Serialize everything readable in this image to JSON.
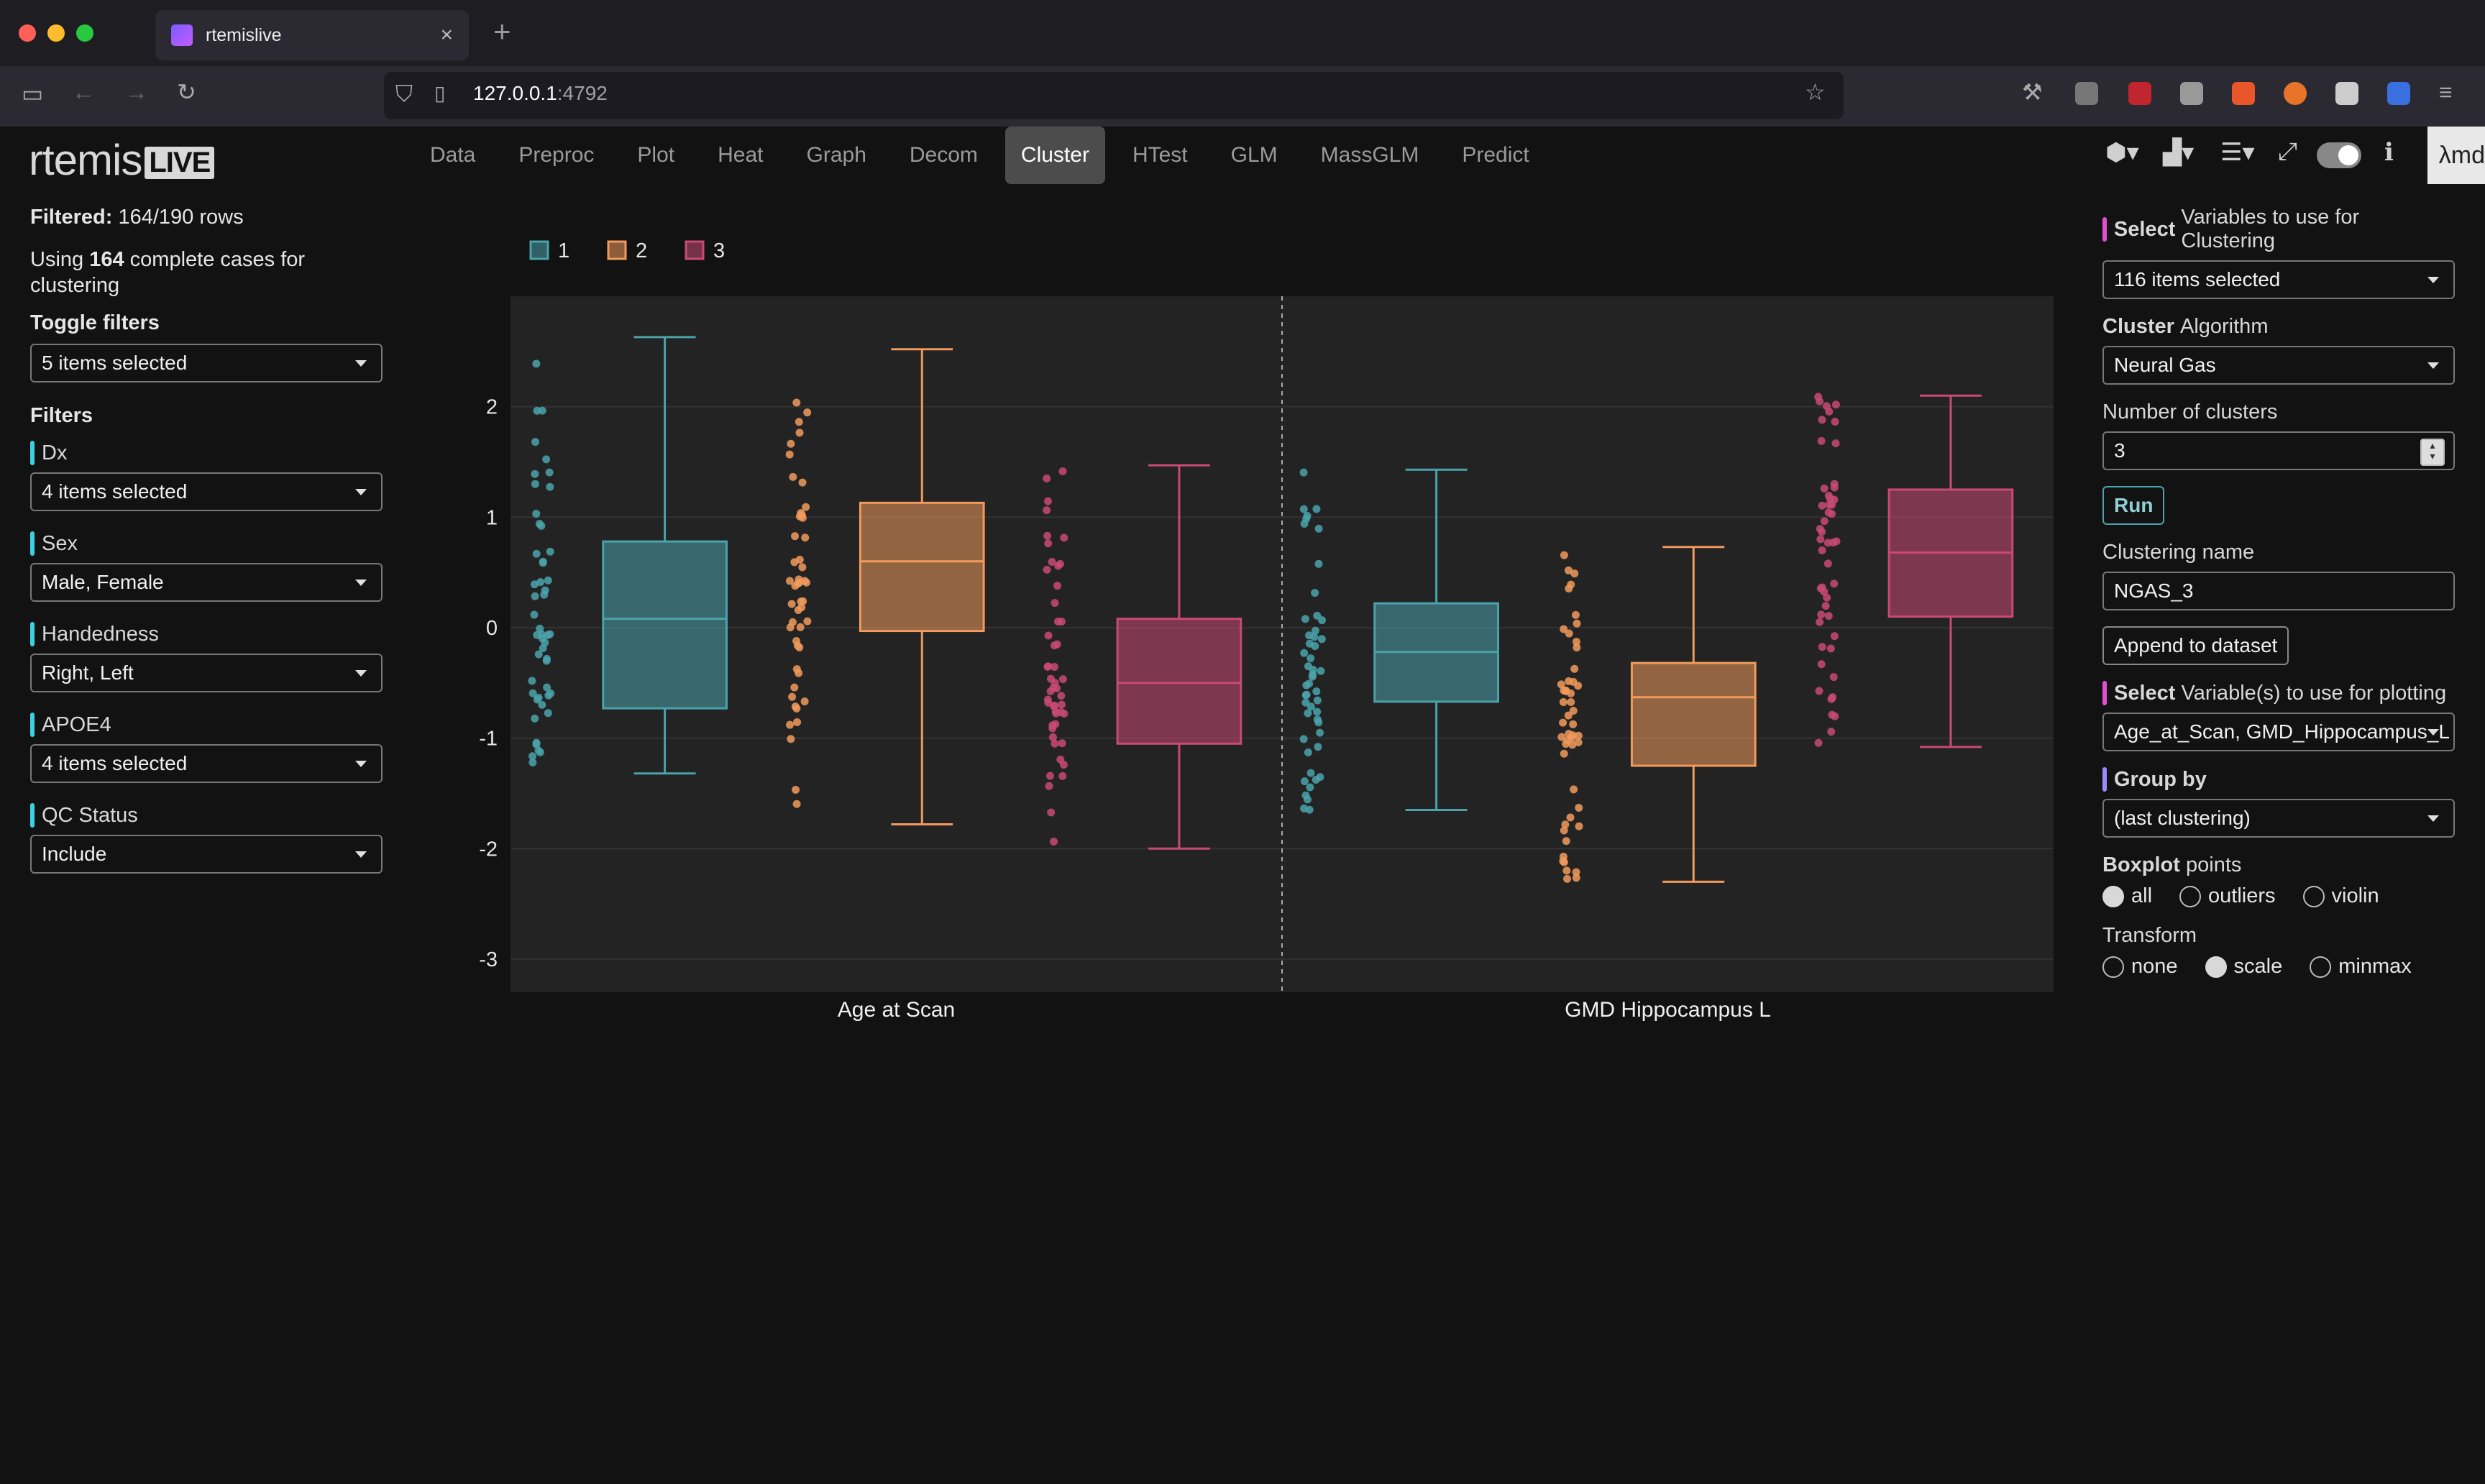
{
  "browser": {
    "tab_title": "rtemislive",
    "tab_close": "×",
    "new_tab": "+",
    "url_host": "127.0.0.1",
    "url_port": ":4792"
  },
  "app": {
    "logo_main": "rtemis",
    "logo_live": "LIVE",
    "nav": [
      "Data",
      "Preproc",
      "Plot",
      "Heat",
      "Graph",
      "Decom",
      "Cluster",
      "HTest",
      "GLM",
      "MassGLM",
      "Predict"
    ],
    "active_nav": "Cluster",
    "brand_corner": "λmd"
  },
  "left": {
    "filtered_label": "Filtered:",
    "filtered_value": "164/190 rows",
    "cases_pre": "Using",
    "cases_count": "164",
    "cases_post1": "complete cases for",
    "cases_post2": "clustering",
    "toggle_title": "Toggle filters",
    "toggle_value": "5 items selected",
    "filters_title": "Filters",
    "filters": [
      {
        "label": "Dx",
        "value": "4 items selected"
      },
      {
        "label": "Sex",
        "value": "Male, Female"
      },
      {
        "label": "Handedness",
        "value": "Right, Left"
      },
      {
        "label": "APOE4",
        "value": "4 items selected"
      },
      {
        "label": "QC Status",
        "value": "Include"
      }
    ]
  },
  "right": {
    "vars_bold": "Select",
    "vars_rest": "Variables to use for Clustering",
    "vars_value": "116 items selected",
    "algo_bold": "Cluster",
    "algo_rest": "Algorithm",
    "algo_value": "Neural Gas",
    "nclust_label": "Number of clusters",
    "nclust_value": "3",
    "run_label": "Run",
    "cname_label": "Clustering name",
    "cname_value": "NGAS_3",
    "append_label": "Append to dataset",
    "plotvars_bold": "Select",
    "plotvars_rest": "Variable(s) to use for plotting",
    "plotvars_value": "Age_at_Scan, GMD_Hippocampus_L",
    "groupby_label": "Group by",
    "groupby_value": "(last clustering)",
    "boxplot_bold": "Boxplot",
    "boxplot_rest": "points",
    "boxplot_options": [
      "all",
      "outliers",
      "violin"
    ],
    "boxplot_selected": "all",
    "transform_label": "Transform",
    "transform_options": [
      "none",
      "scale",
      "minmax"
    ],
    "transform_selected": "scale"
  },
  "colors": {
    "cluster1": "#4aa3ab",
    "cluster2": "#f19a5c",
    "cluster3": "#c94a74",
    "accent_pink": "#e04fd0",
    "accent_cyan": "#3fd0e0",
    "accent_violet": "#9a8cff"
  },
  "chart_data": {
    "type": "box",
    "categories": [
      "Age at Scan",
      "GMD Hippocampus L"
    ],
    "legend": [
      "1",
      "2",
      "3"
    ],
    "ylim": [
      -3.3,
      3.0
    ],
    "yticks": [
      -3,
      -2,
      -1,
      0,
      1,
      2
    ],
    "legend_position": "top-left",
    "series": [
      {
        "name": "1",
        "boxes": [
          {
            "min": -1.32,
            "q1": -0.73,
            "median": 0.08,
            "q3": 0.78,
            "max": 2.63
          },
          {
            "min": -1.65,
            "q1": -0.67,
            "median": -0.22,
            "q3": 0.22,
            "max": 1.43
          }
        ]
      },
      {
        "name": "2",
        "boxes": [
          {
            "min": -1.78,
            "q1": -0.03,
            "median": 0.6,
            "q3": 1.13,
            "max": 2.52
          },
          {
            "min": -2.3,
            "q1": -1.25,
            "median": -0.63,
            "q3": -0.32,
            "max": 0.73
          }
        ]
      },
      {
        "name": "3",
        "boxes": [
          {
            "min": -2.0,
            "q1": -1.05,
            "median": -0.5,
            "q3": 0.08,
            "max": 1.47
          },
          {
            "min": -1.08,
            "q1": 0.1,
            "median": 0.68,
            "q3": 1.25,
            "max": 2.1
          }
        ]
      }
    ]
  }
}
